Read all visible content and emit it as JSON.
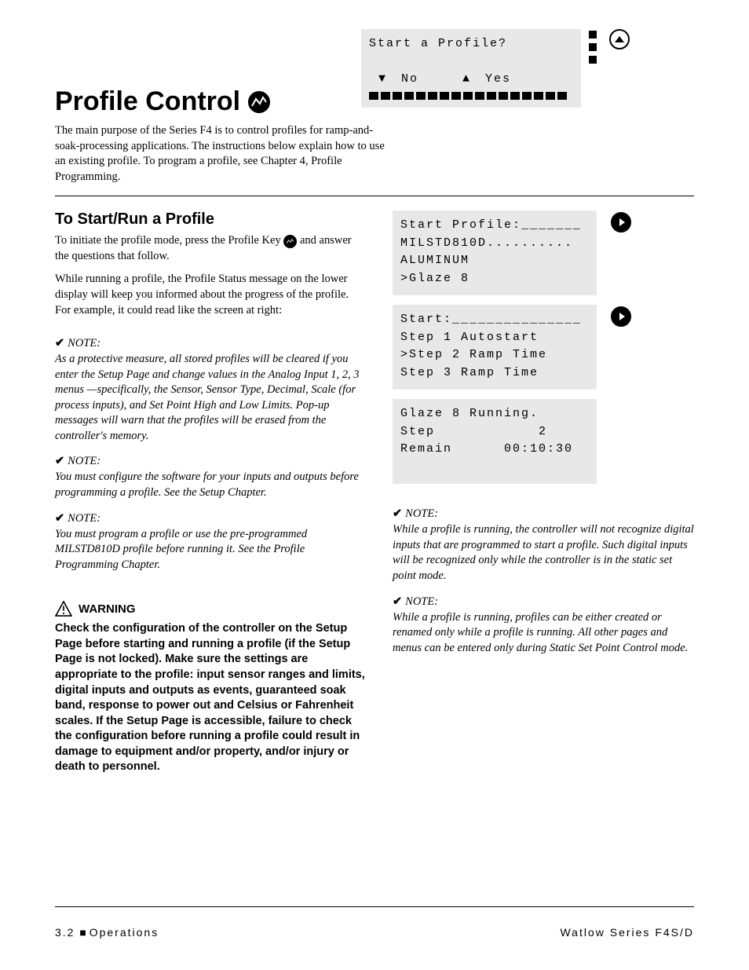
{
  "title": "Profile Control",
  "intro_paragraph": "The main purpose of the Series F4 is to control profiles for ramp-and-soak-processing applications. The instructions below explain how to use an existing profile. To program a profile, see Chapter 4, Profile Programming.",
  "section_heading": "To Start/Run a Profile",
  "para1_part1": "To initiate the profile mode, press the Profile Key ",
  "para1_part2": " and answer the questions that follow.",
  "para2": "While running a profile, the Profile Status message on the lower display will keep you informed about the progress of the profile. For example, it could read like the screen at right:",
  "notes_left": [
    "As a protective measure, all stored profiles will be cleared if you enter the Setup Page and change values in the Analog Input 1, 2, 3 menus —specifically, the Sensor, Sensor Type, Decimal, Scale (for process inputs), and Set Point High and Low Limits. Pop-up messages will warn that the profiles will be erased from the controller's memory.",
    "You must configure the software for your inputs and outputs before programming a profile. See the Setup Chapter.",
    "You must program a profile or use the pre-programmed MILSTD810D profile before running it. See the Profile Programming Chapter."
  ],
  "note_label": "NOTE:",
  "warning_label": "WARNING",
  "warning_body": "Check the configuration of the controller on the Setup Page before starting and running a profile (if the Setup Page is not locked). Make sure the settings are appropriate to the profile: input sensor ranges and limits, digital inputs and outputs as events, guaranteed soak band, response to power out and Celsius or Fahrenheit scales. If the Setup Page is accessible, failure to check the configuration before running a profile could result in damage to equipment and/or property, and/or injury or death to personnel.",
  "notes_right": [
    "While a profile is running, the controller will not recognize digital inputs that are programmed to start a profile. Such digital inputs will be recognized only while the controller is in the static set point mode.",
    "While a profile is running, profiles can be either created or renamed only while a profile is running. All other pages and menus can be entered only during Static Set Point Control mode."
  ],
  "screens": {
    "top": {
      "line1": "Start a Profile?",
      "line2_no": "No",
      "line2_yes": "Yes"
    },
    "s1": {
      "l1": "Start Profile:_______",
      "l2": " MILSTD810D..........",
      "l3": " ALUMINUM",
      "l4": ">Glaze 8"
    },
    "s2": {
      "l1": "Start:_______________",
      "l2": " Step 1 Autostart",
      "l3": ">Step 2 Ramp Time",
      "l4": " Step 3 Ramp Time"
    },
    "s3": {
      "l1": "Glaze 8 Running.",
      "l2": "Step            2",
      "l3": "Remain      00:10:30"
    }
  },
  "footer_left_num": "3.2",
  "footer_left_text": "Operations",
  "footer_right": "Watlow Series F4S/D"
}
